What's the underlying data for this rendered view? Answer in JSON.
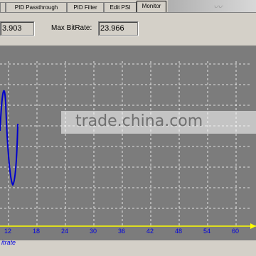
{
  "tabs": [
    {
      "label": "PID Passthrough"
    },
    {
      "label": "PID Filter"
    },
    {
      "label": "Edit PSI"
    },
    {
      "label": "Monitor",
      "active": true
    }
  ],
  "stats": {
    "current_value": "3.903",
    "max_label": "Max BitRate:",
    "max_value": "23.966"
  },
  "graph": {
    "x_label": "itrate",
    "x_ticks": [
      "12",
      "18",
      "24",
      "30",
      "36",
      "42",
      "48",
      "54",
      "60"
    ]
  },
  "watermark": {
    "text": "trade.china.com"
  },
  "colors": {
    "plot_bg": "#7c7c7c",
    "grid": "#ffffff",
    "line": "#0000cc",
    "axis": "#ffff00",
    "tick_text": "#0000e0"
  }
}
